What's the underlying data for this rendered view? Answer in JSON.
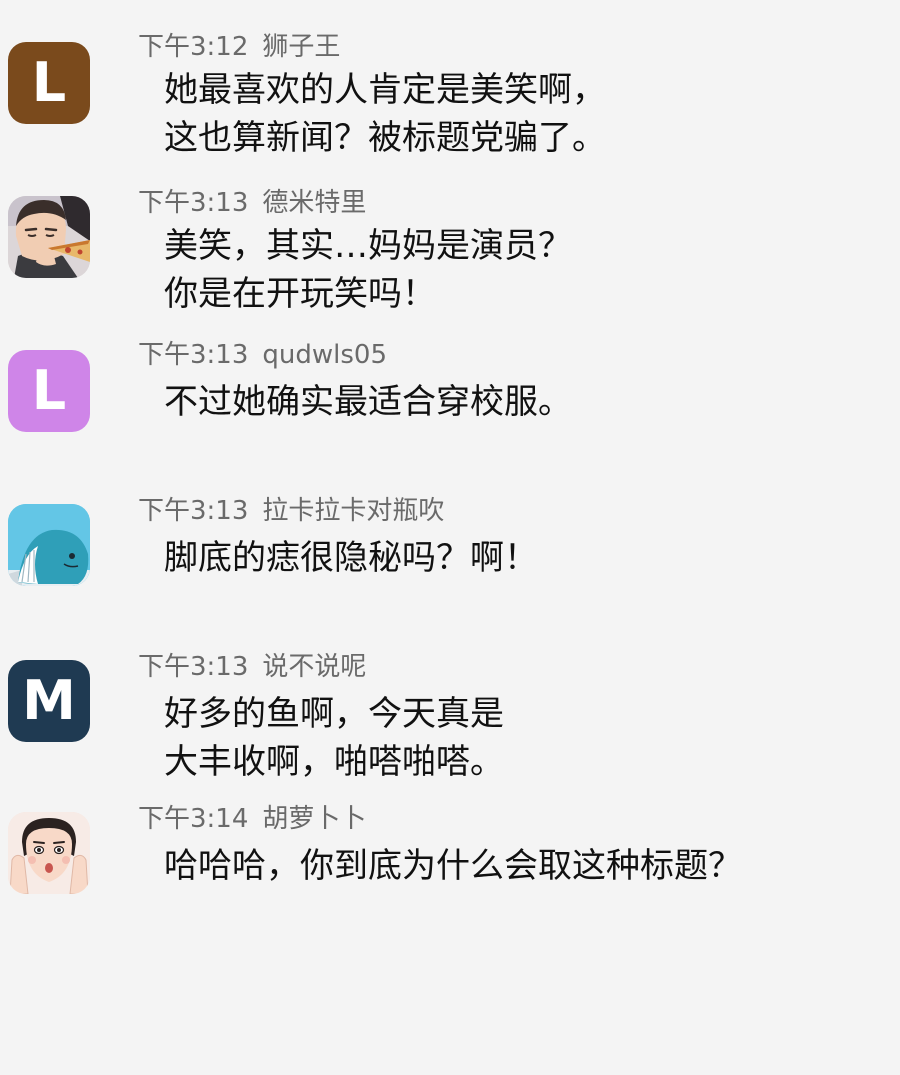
{
  "colors": {
    "background": "#f4f4f4",
    "meta_text": "#6a6a6a",
    "message_text": "#111111"
  },
  "messages": [
    {
      "time": "下午3:12",
      "sender": "狮子王",
      "avatar": {
        "type": "letter",
        "letter": "L",
        "color": "#7a4a1c"
      },
      "lines": [
        "她最喜欢的人肯定是美笑啊，",
        "这也算新闻？被标题党骗了。"
      ]
    },
    {
      "time": "下午3:13",
      "sender": "德米特里",
      "avatar": {
        "type": "image",
        "icon": "man-eating-pizza-avatar"
      },
      "lines": [
        "美笑，其实…妈妈是演员？",
        "你是在开玩笑吗！"
      ]
    },
    {
      "time": "下午3:13",
      "sender": "qudwls05",
      "avatar": {
        "type": "letter",
        "letter": "L",
        "color": "#cf85e8"
      },
      "lines": [
        "不过她确实最适合穿校服。"
      ]
    },
    {
      "time": "下午3:13",
      "sender": "拉卡拉卡对瓶吹",
      "avatar": {
        "type": "image",
        "icon": "whale-avatar"
      },
      "lines": [
        "脚底的痣很隐秘吗？啊！"
      ]
    },
    {
      "time": "下午3:13",
      "sender": "说不说呢",
      "avatar": {
        "type": "letter",
        "letter": "M",
        "color": "#1f3a52"
      },
      "lines": [
        "好多的鱼啊，今天真是",
        "大丰收啊，啪嗒啪嗒。"
      ]
    },
    {
      "time": "下午3:14",
      "sender": "胡萝卜卜",
      "avatar": {
        "type": "image",
        "icon": "surprised-woman-avatar"
      },
      "lines": [
        "哈哈哈，你到底为什么会取这种标题？"
      ]
    }
  ]
}
